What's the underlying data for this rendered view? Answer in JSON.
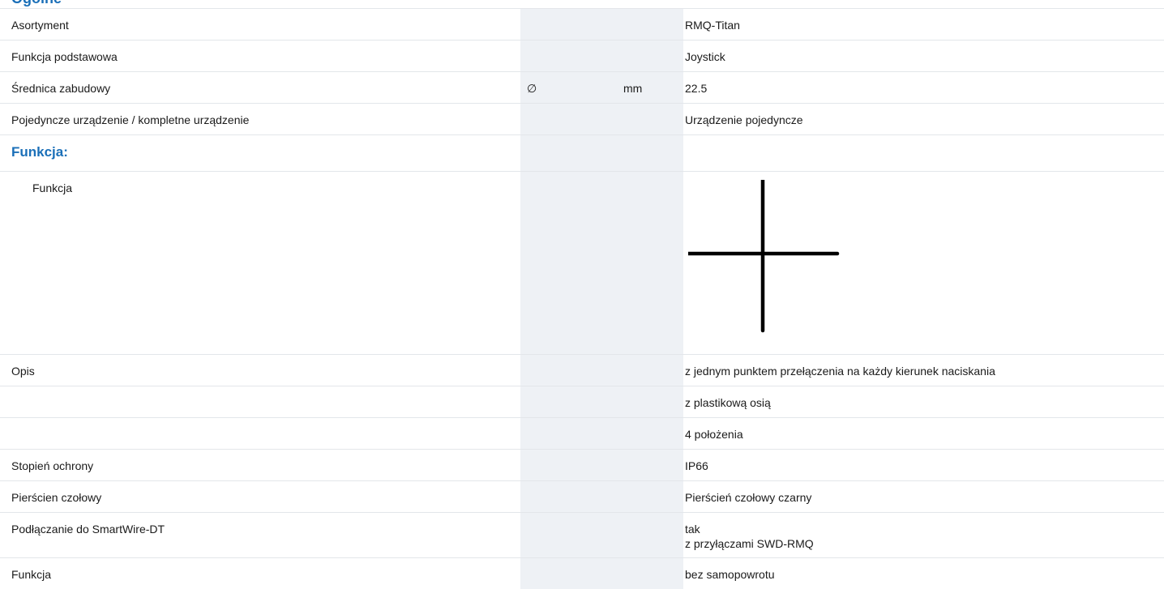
{
  "top_heading": "Ogólne",
  "rows": [
    {
      "label": "Asortyment",
      "symbol": "",
      "unit": "",
      "value": "RMQ-Titan"
    },
    {
      "label": "Funkcja podstawowa",
      "symbol": "",
      "unit": "",
      "value": "Joystick"
    },
    {
      "label": "Średnica zabudowy",
      "symbol": "∅",
      "unit": "mm",
      "value": "22.5"
    },
    {
      "label": "Pojedyncze urządzenie / kompletne urządzenie",
      "symbol": "",
      "unit": "",
      "value": "Urządzenie pojedyncze"
    }
  ],
  "section": {
    "title": "Funkcja:"
  },
  "function_row": {
    "label": "Funkcja",
    "symbol_icon": "joystick-cross-symbol-icon"
  },
  "rows2": [
    {
      "label": "Opis",
      "value": "z jednym punktem przełączenia na każdy kierunek naciskania"
    },
    {
      "label": "",
      "value": "z plastikową osią"
    },
    {
      "label": "",
      "value": "4 położenia"
    },
    {
      "label": "Stopień ochrony",
      "value": "IP66"
    },
    {
      "label": "Pierścien czołowy",
      "value": "Pierścień czołowy czarny"
    }
  ],
  "smartwire_row": {
    "label": "Podłączanie do SmartWire-DT",
    "value_line1": "tak",
    "value_line2": "z przyłączami SWD-RMQ"
  },
  "last_row": {
    "label": "Funkcja",
    "value": "bez samopowrotu"
  },
  "colors": {
    "accent": "#1a6fb8",
    "shaded_column": "#eef1f5",
    "divider": "#e3e6ea"
  }
}
